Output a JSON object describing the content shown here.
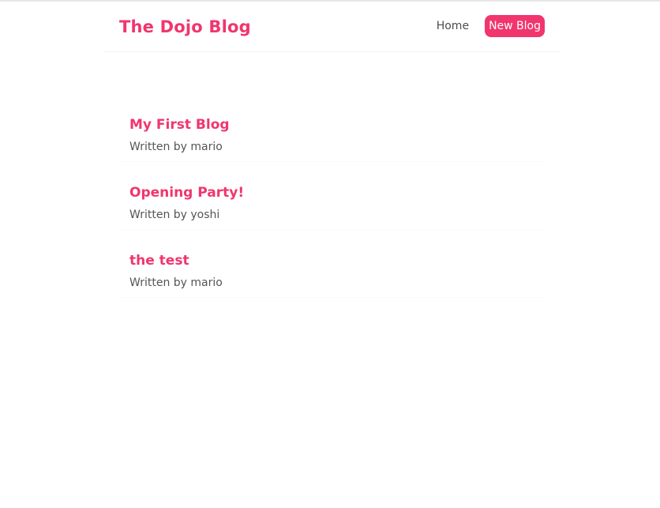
{
  "navbar": {
    "brand": "The Dojo Blog",
    "home_label": "Home",
    "new_blog_label": "New Blog"
  },
  "blogs": [
    {
      "title": "My First Blog",
      "author_line": "Written by mario"
    },
    {
      "title": "Opening Party!",
      "author_line": "Written by yoshi"
    },
    {
      "title": "the test",
      "author_line": "Written by mario"
    }
  ],
  "colors": {
    "accent": "#f1356d",
    "text_muted": "#555555"
  }
}
